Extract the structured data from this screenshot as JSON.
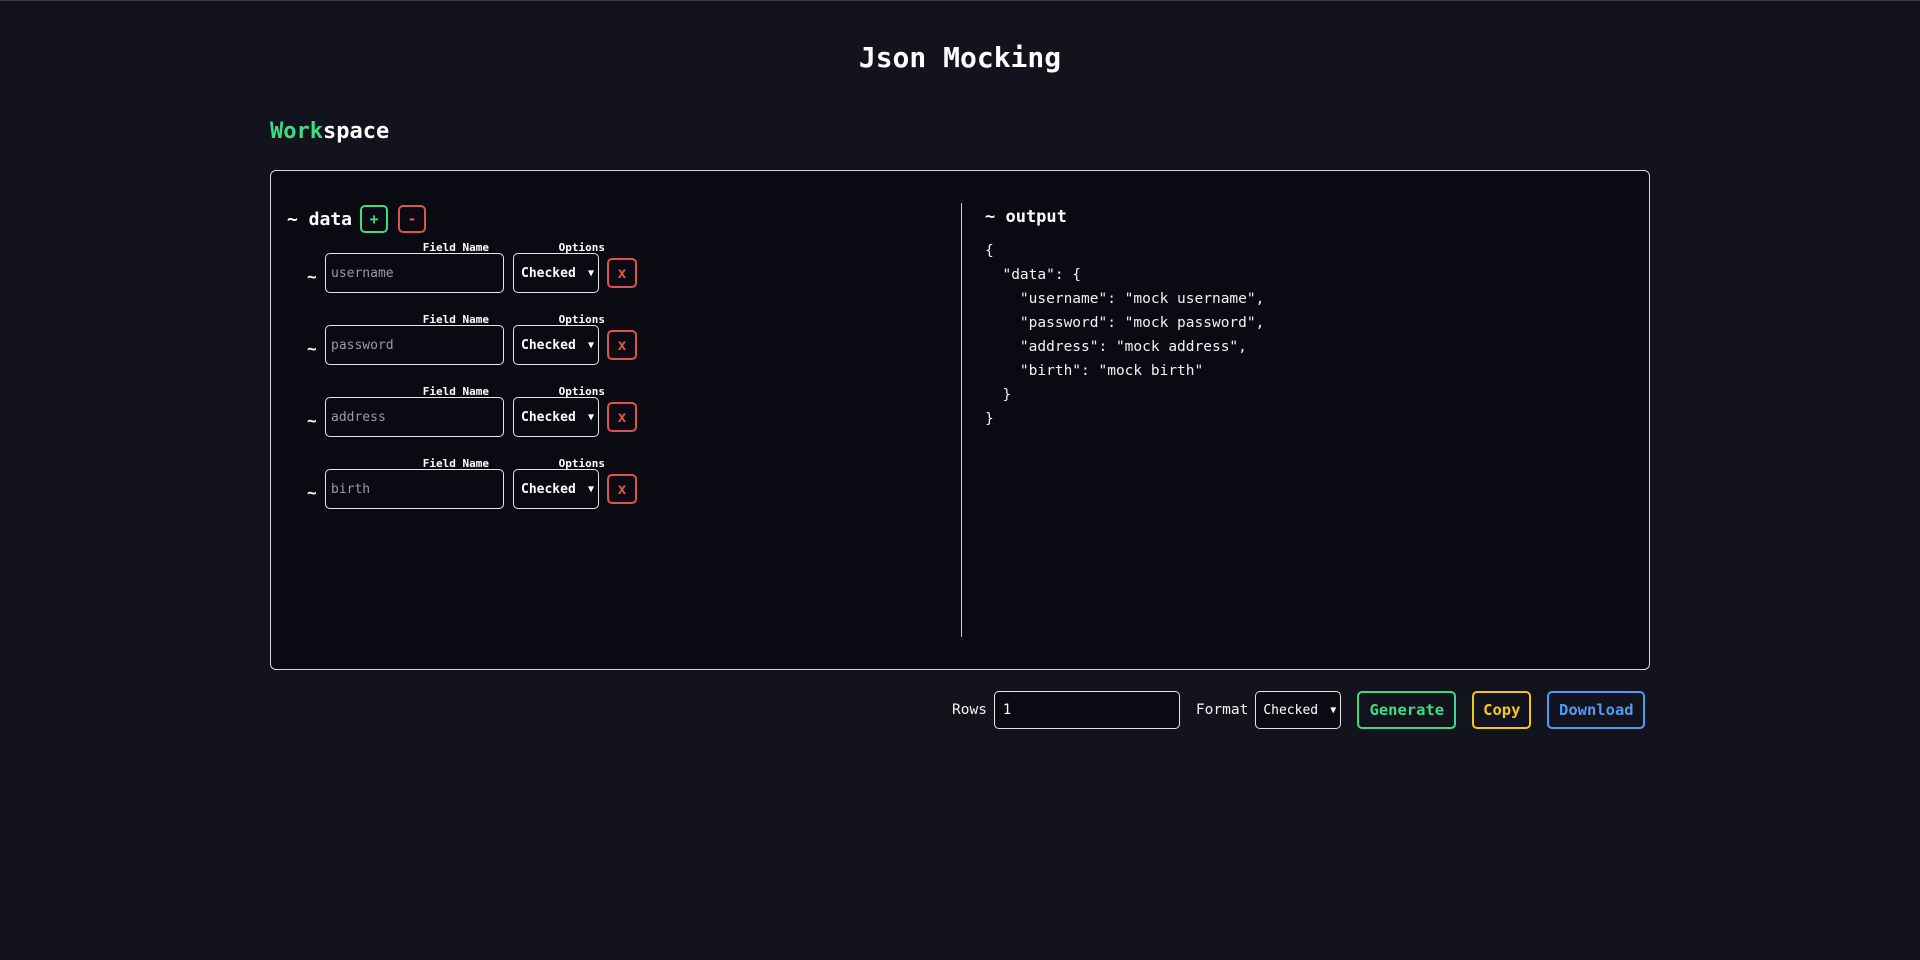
{
  "app": {
    "title": "Json Mocking"
  },
  "workspace": {
    "heading_accent": "Work",
    "heading_rest": "space"
  },
  "data_panel": {
    "title": "~ data",
    "add_label": "+",
    "remove_label": "-",
    "field_name_label": "Field Name",
    "options_label": "Options",
    "row_prefix": "~",
    "delete_label": "x",
    "fields": [
      {
        "placeholder": "username",
        "value": "",
        "option": "Checked"
      },
      {
        "placeholder": "password",
        "value": "",
        "option": "Checked"
      },
      {
        "placeholder": "address",
        "value": "",
        "option": "Checked"
      },
      {
        "placeholder": "birth",
        "value": "",
        "option": "Checked"
      }
    ]
  },
  "output_panel": {
    "title": "~ output",
    "code": "{\n  \"data\": {\n    \"username\": \"mock username\",\n    \"password\": \"mock password\",\n    \"address\": \"mock address\",\n    \"birth\": \"mock birth\"\n  }\n}"
  },
  "controls": {
    "rows_label": "Rows",
    "rows_value": "1",
    "format_label": "Format",
    "format_value": "Checked",
    "generate_label": "Generate",
    "copy_label": "Copy",
    "download_label": "Download"
  },
  "icons": {
    "select_chevron": "chevron-down-icon"
  },
  "colors": {
    "background": "#13131d",
    "panel": "#0a0a12",
    "green": "#3ddc84",
    "red": "#e05252",
    "yellow": "#f5c518",
    "blue": "#4f9cf5"
  }
}
